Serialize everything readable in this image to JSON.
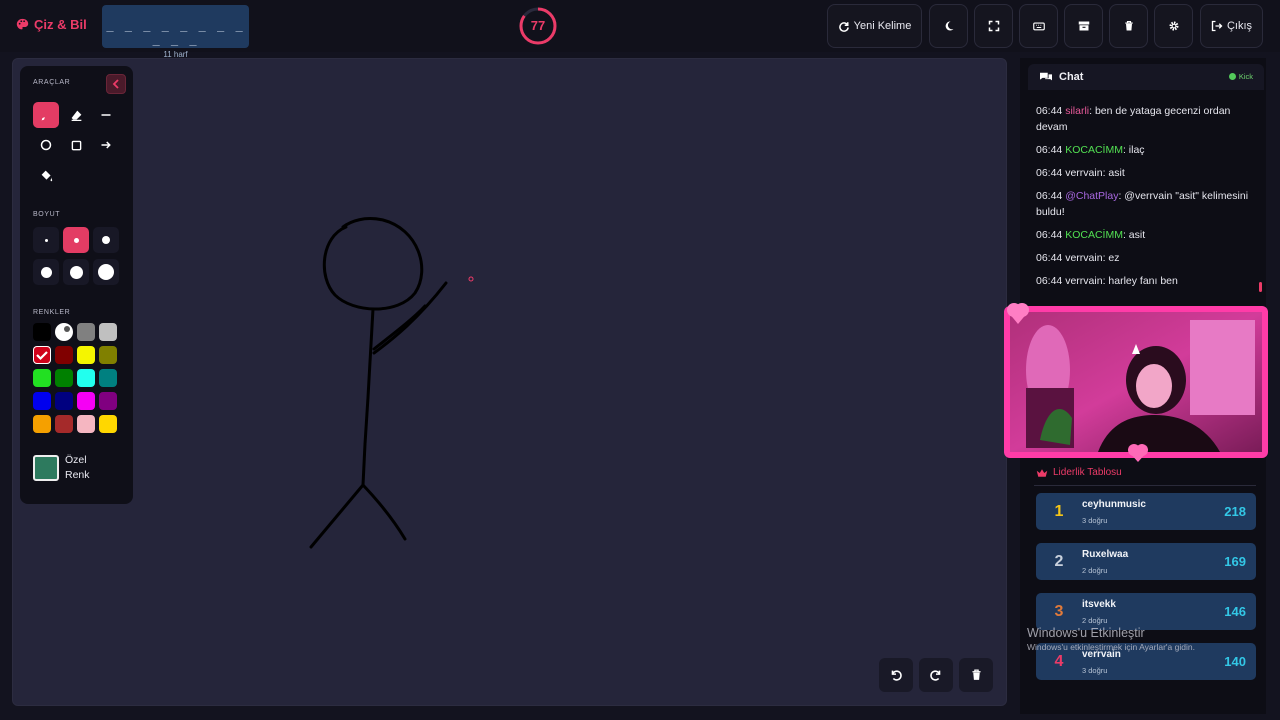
{
  "app": {
    "brand": "Çiz & Bil",
    "brand_color": "#ec3b68"
  },
  "word_hint": {
    "dashes": "_ _ _ _ _ _ _ _ _ _ _",
    "letters": "11 harf"
  },
  "timer": {
    "value": "77",
    "fraction_remaining": 0.85
  },
  "toolbar": {
    "new_word": "Yeni Kelime",
    "logout": "Çıkış",
    "icons": [
      "refresh-icon",
      "moon-icon",
      "fullscreen-icon",
      "keyboard-icon",
      "archive-icon",
      "trash-icon",
      "gear-icon",
      "logout-icon"
    ]
  },
  "tools": {
    "section_tools": "ARAÇLAR",
    "section_size": "BOYUT",
    "section_colors": "RENKLER",
    "custom_color_line1": "Özel",
    "custom_color_line2": "Renk",
    "custom_color_value": "#2d7a5e",
    "active_tool": "brush",
    "active_size_index": 1,
    "selected_color": "#d0021b",
    "colors": [
      "#000000",
      "#ffffff",
      "#808080",
      "#c0c0c0",
      "#d0021b",
      "#800000",
      "#f5f500",
      "#808000",
      "#22e022",
      "#008000",
      "#22ffee",
      "#008080",
      "#0000ee",
      "#000080",
      "#f500f5",
      "#800080",
      "#f5a000",
      "#a52a2a",
      "#f5b6c1",
      "#ffd700"
    ]
  },
  "chat": {
    "title": "Chat",
    "platform": "Kick",
    "messages": [
      {
        "time": "06:44",
        "user": "silarli",
        "color": "#e85a9a",
        "text": ": ben de yataga gecenzi ordan devam"
      },
      {
        "time": "06:44",
        "user": "KOCACİMM",
        "color": "#52e052",
        "text": ": ilaç"
      },
      {
        "time": "06:44",
        "user": "verrvain",
        "color": "#e6e6ee",
        "text": ": asit"
      },
      {
        "time": "06:44",
        "user": "@ChatPlay",
        "color": "#a868e0",
        "text": ": @verrvain \"asit\" kelimesini buldu!"
      },
      {
        "time": "06:44",
        "user": "KOCACİMM",
        "color": "#52e052",
        "text": ": asit"
      },
      {
        "time": "06:44",
        "user": "verrvain",
        "color": "#e6e6ee",
        "text": ": ez"
      },
      {
        "time": "06:44",
        "user": "verrvain",
        "color": "#e6e6ee",
        "text": ": harley fanı ben"
      }
    ]
  },
  "leaderboard": {
    "title": "Liderlik Tablosu",
    "rows": [
      {
        "rank": "1",
        "name": "ceyhunmusic",
        "correct": "3 doğru",
        "score": "218",
        "rank_color": "#f5c518"
      },
      {
        "rank": "2",
        "name": "Ruxelwaa",
        "correct": "2 doğru",
        "score": "169",
        "rank_color": "#c8d0dc"
      },
      {
        "rank": "3",
        "name": "itsvekk",
        "correct": "2 doğru",
        "score": "146",
        "rank_color": "#e07a3a"
      },
      {
        "rank": "4",
        "name": "verrvain",
        "correct": "3 doğru",
        "score": "140",
        "rank_color": "#ec3b68"
      }
    ]
  },
  "watermark": {
    "line1": "Windows'u Etkinleştir",
    "line2": "Windows'u etkinleştirmek için Ayarlar'a gidin."
  }
}
